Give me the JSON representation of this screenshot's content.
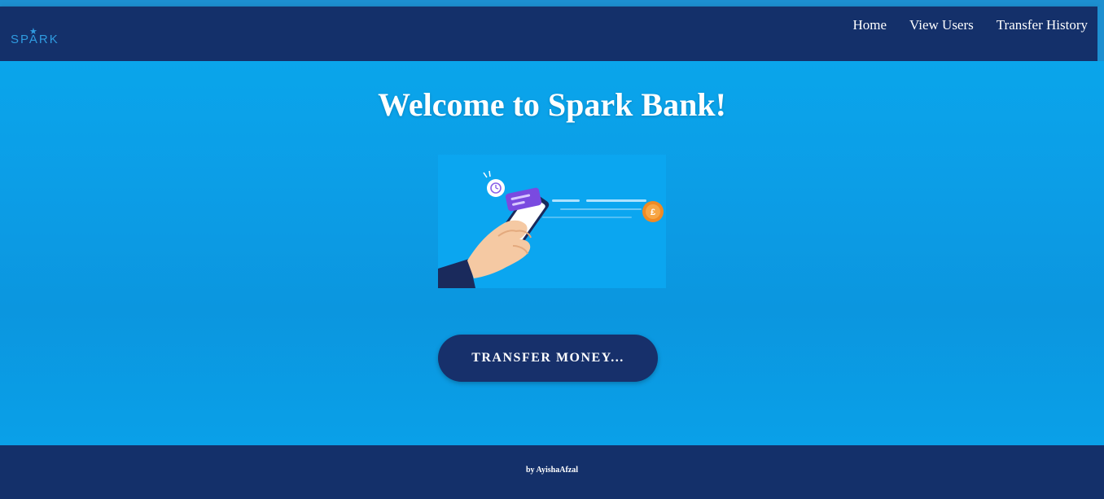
{
  "brand": {
    "logo_text": "SPARK"
  },
  "nav": {
    "items": [
      {
        "label": "Home"
      },
      {
        "label": "View Users"
      },
      {
        "label": "Transfer History"
      }
    ]
  },
  "hero": {
    "title": "Welcome to Spark Bank!",
    "cta_label": "TRANSFER MONEY...",
    "illustration_icon": "hand-holding-phone-payment-icon",
    "coin_symbol": "£"
  },
  "footer": {
    "credit": "by AyishaAfzal"
  },
  "colors": {
    "navbar": "#14306a",
    "hero_background": "#0aa5eb",
    "cta_background": "#17306b",
    "accent": "#2f9be0",
    "coin": "#f08a24",
    "phone_card": "#7a4ae0"
  }
}
